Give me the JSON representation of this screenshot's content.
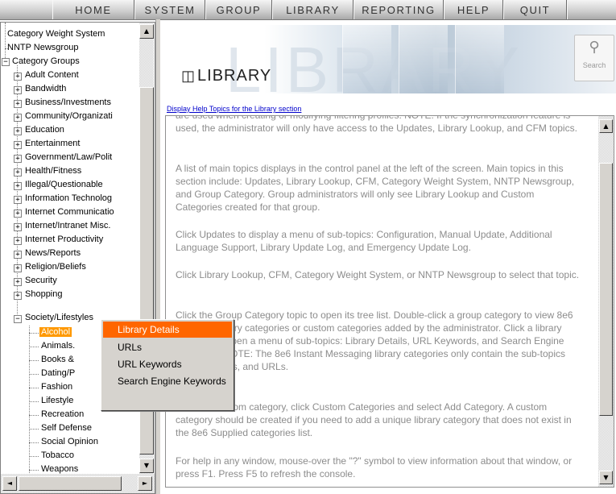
{
  "menu": {
    "items": [
      "HOME",
      "SYSTEM",
      "GROUP",
      "LIBRARY",
      "REPORTING",
      "HELP",
      "QUIT"
    ]
  },
  "tree": {
    "top_items": [
      "Category Weight System",
      "NNTP Newsgroup"
    ],
    "groups_label": "Category Groups",
    "groups": [
      "Adult Content",
      "Bandwidth",
      "Business/Investments",
      "Community/Organizati",
      "Education",
      "Entertainment",
      "Government/Law/Polit",
      "Health/Fitness",
      "Illegal/Questionable",
      "Information Technolog",
      "Internet Communicatio",
      "Internet/Intranet Misc.",
      "Internet Productivity",
      "News/Reports",
      "Religion/Beliefs",
      "Security",
      "Shopping"
    ],
    "expanded_group": "Society/Lifestyles",
    "children": [
      "Alcohol",
      "Animals.",
      "Books &",
      "Dating/P",
      "Fashion",
      "Lifestyle",
      "Recreation",
      "Self Defense",
      "Social Opinion",
      "Tobacco",
      "Weapons"
    ],
    "selected_child": "Alcohol",
    "expander_plus": "+",
    "expander_minus": "−"
  },
  "banner": {
    "title": "LIBRARY",
    "watermark": "LIBRARY",
    "search_caption": "Search",
    "book_icon": "book-icon",
    "search_icon": "magnifier-icon"
  },
  "help_link": "Display Help Topics for the Library section",
  "content": {
    "paragraphs": [
      "are used when creating or modifying filtering profiles. NOTE: If the synchronization feature is used, the administrator will only have access to the Updates, Library Lookup, and CFM topics.",
      "A list of main topics displays in the control panel at the left of the screen. Main topics in this section include: Updates, Library Lookup, CFM, Category Weight System, NNTP Newsgroup, and Group Category. Group administrators will only see Library Lookup and Custom Categories created for that group.",
      "Click Updates to display a menu of sub-topics: Configuration, Manual Update, Additional Language Support, Library Update Log, and Emergency Update Log.",
      "Click Library Lookup, CFM, Category Weight System, or NNTP Newsgroup to select that topic.",
      "Click the Group Category topic to open its tree list. Double-click a group category to view 8e6 Supplied library categories or custom categories added by the administrator. Click a library category to open a menu of sub-topics: Library Details, URL Keywords, and Search Engine Keywords. NOTE: The 8e6 Instant Messaging library categories only contain the sub-topics Library Details, and URLs.",
      "To add a custom category, click Custom Categories and select Add Category. A custom category should be created if you need to add a unique library category that does not exist in the 8e6 Supplied categories list.",
      "For help in any window, mouse-over the \"?\" symbol to view information about that window, or press F1. Press F5 to refresh the console."
    ]
  },
  "context_menu": {
    "items": [
      "Library Details",
      "URLs",
      "URL Keywords",
      "Search Engine Keywords"
    ],
    "active_index": 0
  },
  "scroll": {
    "up": "▲",
    "down": "▼",
    "left": "◄",
    "right": "►"
  },
  "colors": {
    "selection": "#ff9900",
    "menu_highlight": "#ff6600",
    "link": "#0000cc",
    "help_text": "#8c8c8c"
  }
}
